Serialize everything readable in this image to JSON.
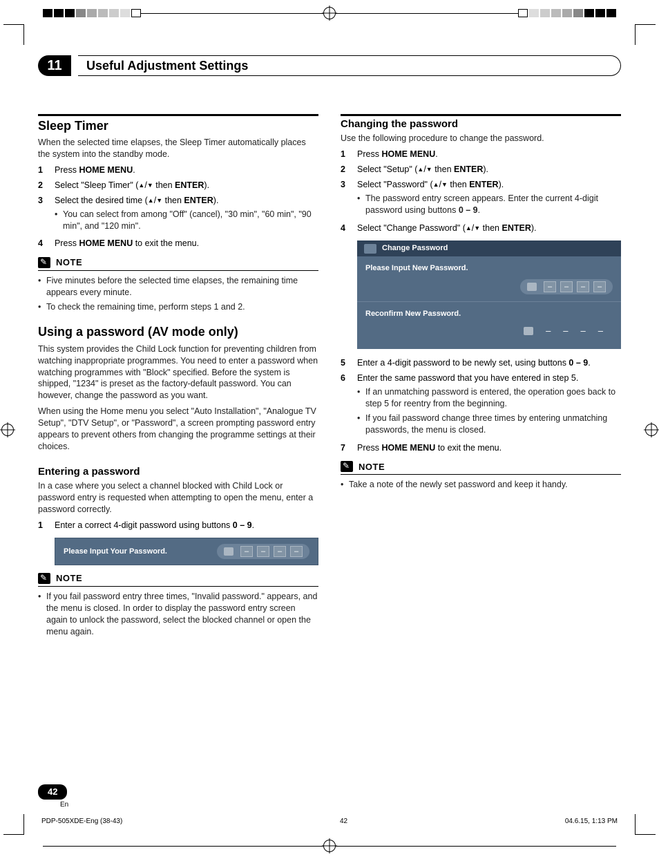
{
  "chapter": {
    "number": "11",
    "title": "Useful Adjustment Settings"
  },
  "sleep_timer": {
    "title": "Sleep Timer",
    "intro": "When the selected time elapses, the Sleep Timer automatically places the system into the standby mode.",
    "steps": {
      "s1_pre": "Press ",
      "s1_b": "HOME MENU",
      "s1_post": ".",
      "s2_pre": "Select \"Sleep Timer\" (",
      "s2_mid": " then ",
      "s2_b": "ENTER",
      "s2_post": ").",
      "s3_pre": "Select the desired time (",
      "s3_mid": " then ",
      "s3_b": "ENTER",
      "s3_post": ").",
      "s3_bullet": "You can select from among \"Off\" (cancel), \"30 min\", \"60 min\", \"90 min\", and \"120 min\".",
      "s4_pre": "Press ",
      "s4_b": "HOME MENU",
      "s4_post": " to exit the menu."
    },
    "note_label": "NOTE",
    "note1": "Five minutes before the selected time elapses, the remaining time appears every minute.",
    "note2": "To check the remaining time, perform steps 1 and 2."
  },
  "using_password": {
    "title": "Using a password (AV mode only)",
    "p1": "This system provides the Child Lock function for preventing children from watching inappropriate programmes. You need to enter a password when watching programmes with \"Block\" specified. Before the system is shipped, \"1234\" is preset as the factory-default password. You can however, change the password as you want.",
    "p2": "When using the Home menu you select \"Auto Installation\", \"Analogue TV Setup\", \"DTV Setup\", or \"Password\", a screen prompting password entry appears to prevent others from changing the programme settings at their choices."
  },
  "entering_password": {
    "title": "Entering a password",
    "intro": "In a case where you select a channel blocked with Child Lock or password entry is requested when attempting to open the menu, enter a password correctly.",
    "s1_pre": "Enter a correct 4-digit password using buttons ",
    "s1_b": "0 – 9",
    "s1_post": ".",
    "panel_label": "Please Input Your Password.",
    "note_label": "NOTE",
    "note1": "If you fail password entry three times, \"Invalid password.\" appears, and the menu is closed. In order to display the password entry screen again to unlock the password, select the blocked channel or open the menu again."
  },
  "changing_password": {
    "title": "Changing the password",
    "intro": "Use the following procedure to change the password.",
    "s1_pre": "Press ",
    "s1_b": "HOME MENU",
    "s1_post": ".",
    "s2_pre": "Select \"Setup\" (",
    "s2_mid": " then ",
    "s2_b": "ENTER",
    "s2_post": ").",
    "s3_pre": "Select \"Password\" (",
    "s3_mid": " then ",
    "s3_b": "ENTER",
    "s3_post": ").",
    "s3_bullet_pre": "The password entry screen appears. Enter the current 4-digit password using buttons ",
    "s3_bullet_b": "0 – 9",
    "s3_bullet_post": ".",
    "s4_pre": "Select \"Change Password\" (",
    "s4_mid": " then ",
    "s4_b": "ENTER",
    "s4_post": ").",
    "panel": {
      "header": "Change Password",
      "label1": "Please Input New Password.",
      "label2": "Reconfirm New Password."
    },
    "s5_pre": "Enter a 4-digit password to be newly set, using buttons ",
    "s5_b": "0 – 9",
    "s5_post": ".",
    "s6": "Enter the same password that you have entered in step 5.",
    "s6_bullet1": "If an unmatching password is entered, the operation goes back to step 5 for reentry from the beginning.",
    "s6_bullet2": "If you fail password change three times by entering unmatching passwords, the menu is closed.",
    "s7_pre": "Press ",
    "s7_b": "HOME MENU",
    "s7_post": " to exit the menu.",
    "note_label": "NOTE",
    "note1": "Take a note of the newly set password and keep it handy."
  },
  "footer": {
    "page_number": "42",
    "lang": "En",
    "doc_id": "PDP-505XDE-Eng (38-43)",
    "folio": "42",
    "datetime": "04.6.15, 1:13 PM"
  }
}
